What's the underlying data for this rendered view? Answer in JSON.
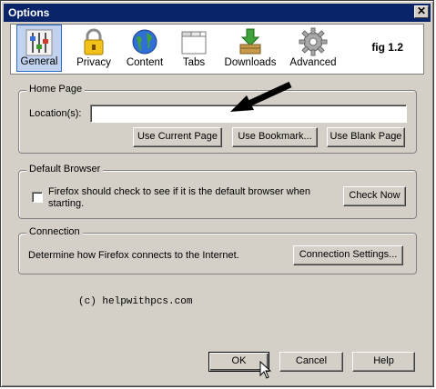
{
  "window": {
    "title": "Options",
    "close_label": "✕",
    "figure_label": "fig 1.2"
  },
  "toolbar": {
    "items": [
      {
        "label": "General",
        "icon": "sliders-icon",
        "selected": true
      },
      {
        "label": "Privacy",
        "icon": "padlock-icon"
      },
      {
        "label": "Content",
        "icon": "globe-icon"
      },
      {
        "label": "Tabs",
        "icon": "tabs-window-icon"
      },
      {
        "label": "Downloads",
        "icon": "download-box-icon"
      },
      {
        "label": "Advanced",
        "icon": "gear-icon"
      }
    ]
  },
  "home_page": {
    "group_label": "Home Page",
    "location_label": "Location(s):",
    "location_value": "",
    "buttons": {
      "use_current": "Use Current Page",
      "use_bookmark": "Use Bookmark...",
      "use_blank": "Use Blank Page"
    }
  },
  "default_browser": {
    "group_label": "Default Browser",
    "check_text_line1": "Firefox should check to see if it is the default browser when",
    "check_text_line2": "starting.",
    "checked": false,
    "check_now": "Check Now"
  },
  "connection": {
    "group_label": "Connection",
    "description": "Determine how Firefox connects to the Internet.",
    "settings_button": "Connection Settings..."
  },
  "watermark": "(c) helpwithpcs.com",
  "footer": {
    "ok": "OK",
    "cancel": "Cancel",
    "help": "Help"
  }
}
